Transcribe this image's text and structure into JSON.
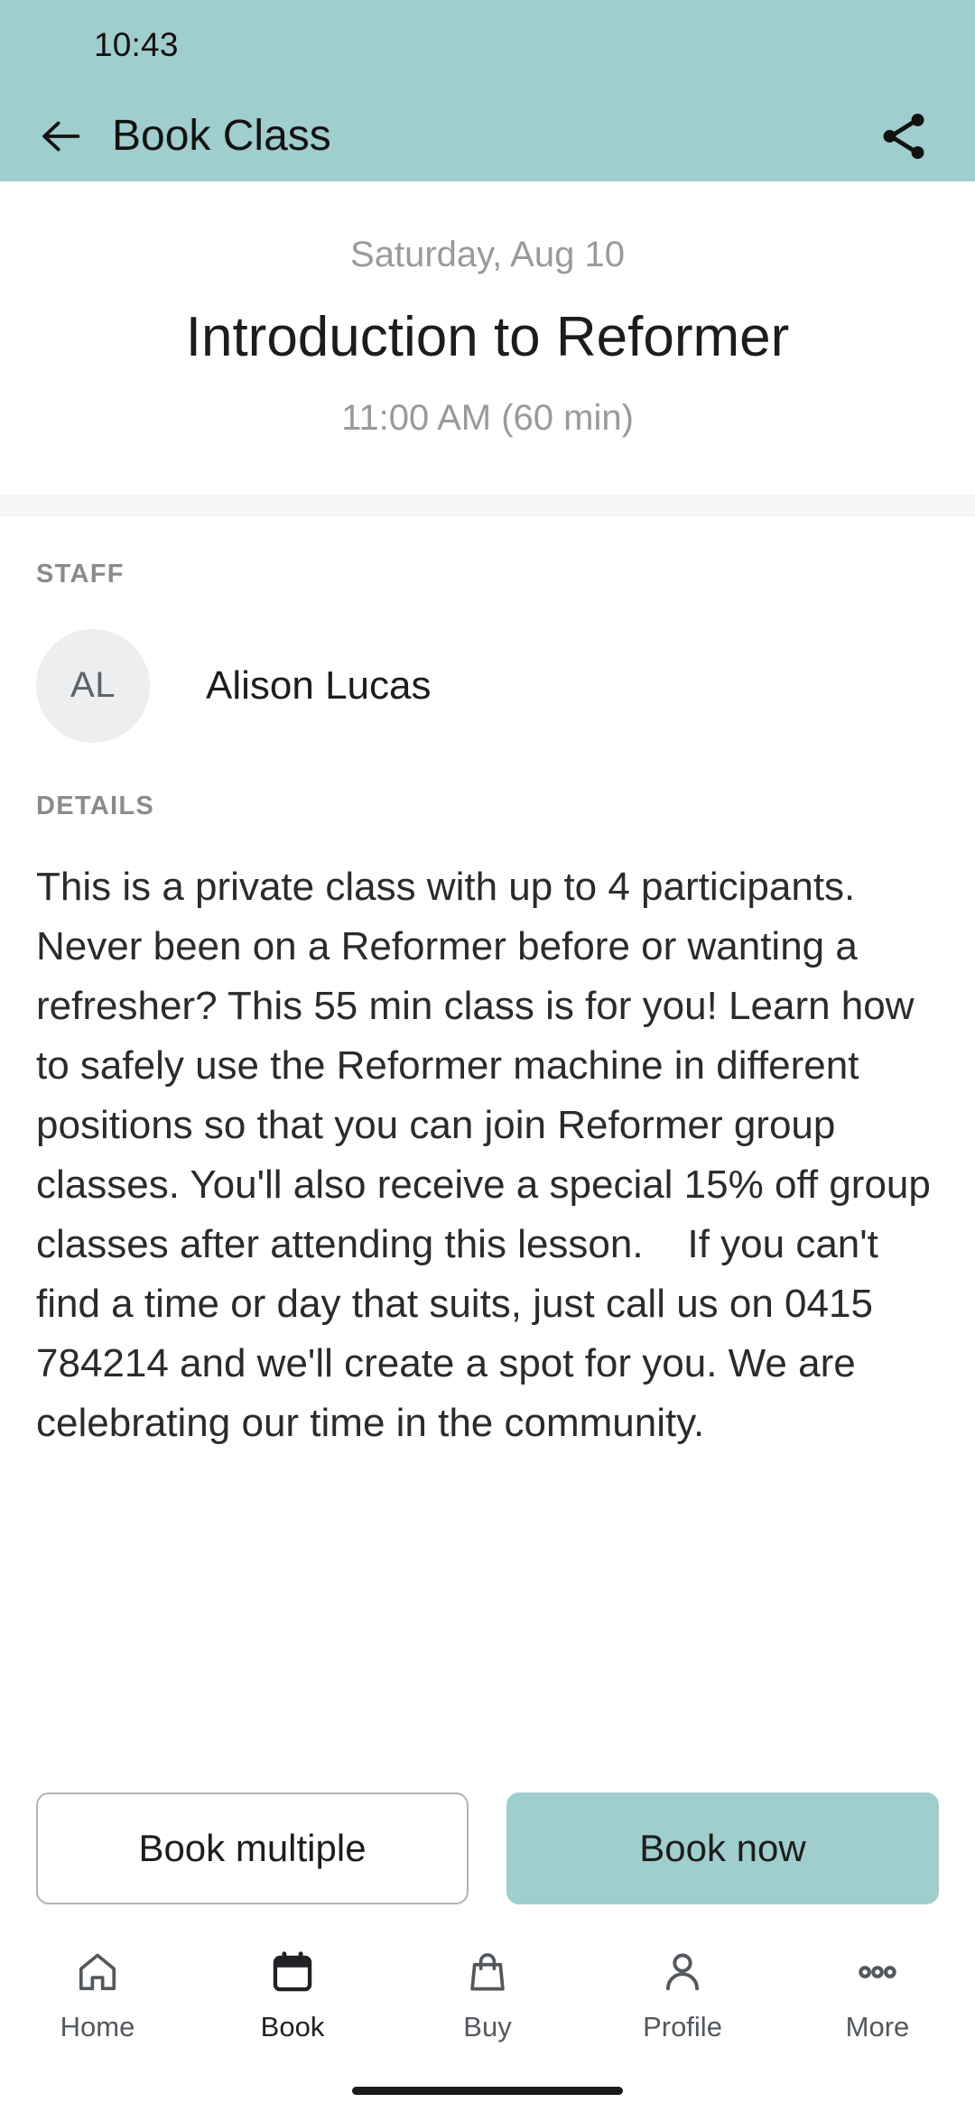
{
  "status_bar": {
    "time": "10:43"
  },
  "app_bar": {
    "title": "Book Class",
    "back_icon": "arrow-left-icon",
    "share_icon": "share-icon",
    "background_color": "#a0cdcd"
  },
  "class_header": {
    "date": "Saturday, Aug 10",
    "title": "Introduction to Reformer",
    "time": "11:00 AM (60 min)"
  },
  "staff": {
    "section_label": "STAFF",
    "members": [
      {
        "initials": "AL",
        "name": "Alison Lucas"
      }
    ]
  },
  "details": {
    "section_label": "DETAILS",
    "text": "This is a private class with up to 4 participants. Never been on a Reformer before or wanting a refresher? This 55 min class is for you! Learn how to safely use the Reformer machine in different positions so that you can join Reformer group classes. You'll also receive a special 15% off group classes after attending this lesson.    If you can't find a time or day that suits, just call us on 0415 784214 and we'll create a spot for you. We are celebrating our time in the community."
  },
  "actions": {
    "secondary_label": "Book multiple",
    "primary_label": "Book now",
    "primary_color": "#a0cdcd"
  },
  "bottom_nav": {
    "items": [
      {
        "label": "Home",
        "icon": "home-icon",
        "active": false
      },
      {
        "label": "Book",
        "icon": "calendar-icon",
        "active": true
      },
      {
        "label": "Buy",
        "icon": "bag-icon",
        "active": false
      },
      {
        "label": "Profile",
        "icon": "person-icon",
        "active": false
      },
      {
        "label": "More",
        "icon": "ellipsis-icon",
        "active": false
      }
    ]
  }
}
